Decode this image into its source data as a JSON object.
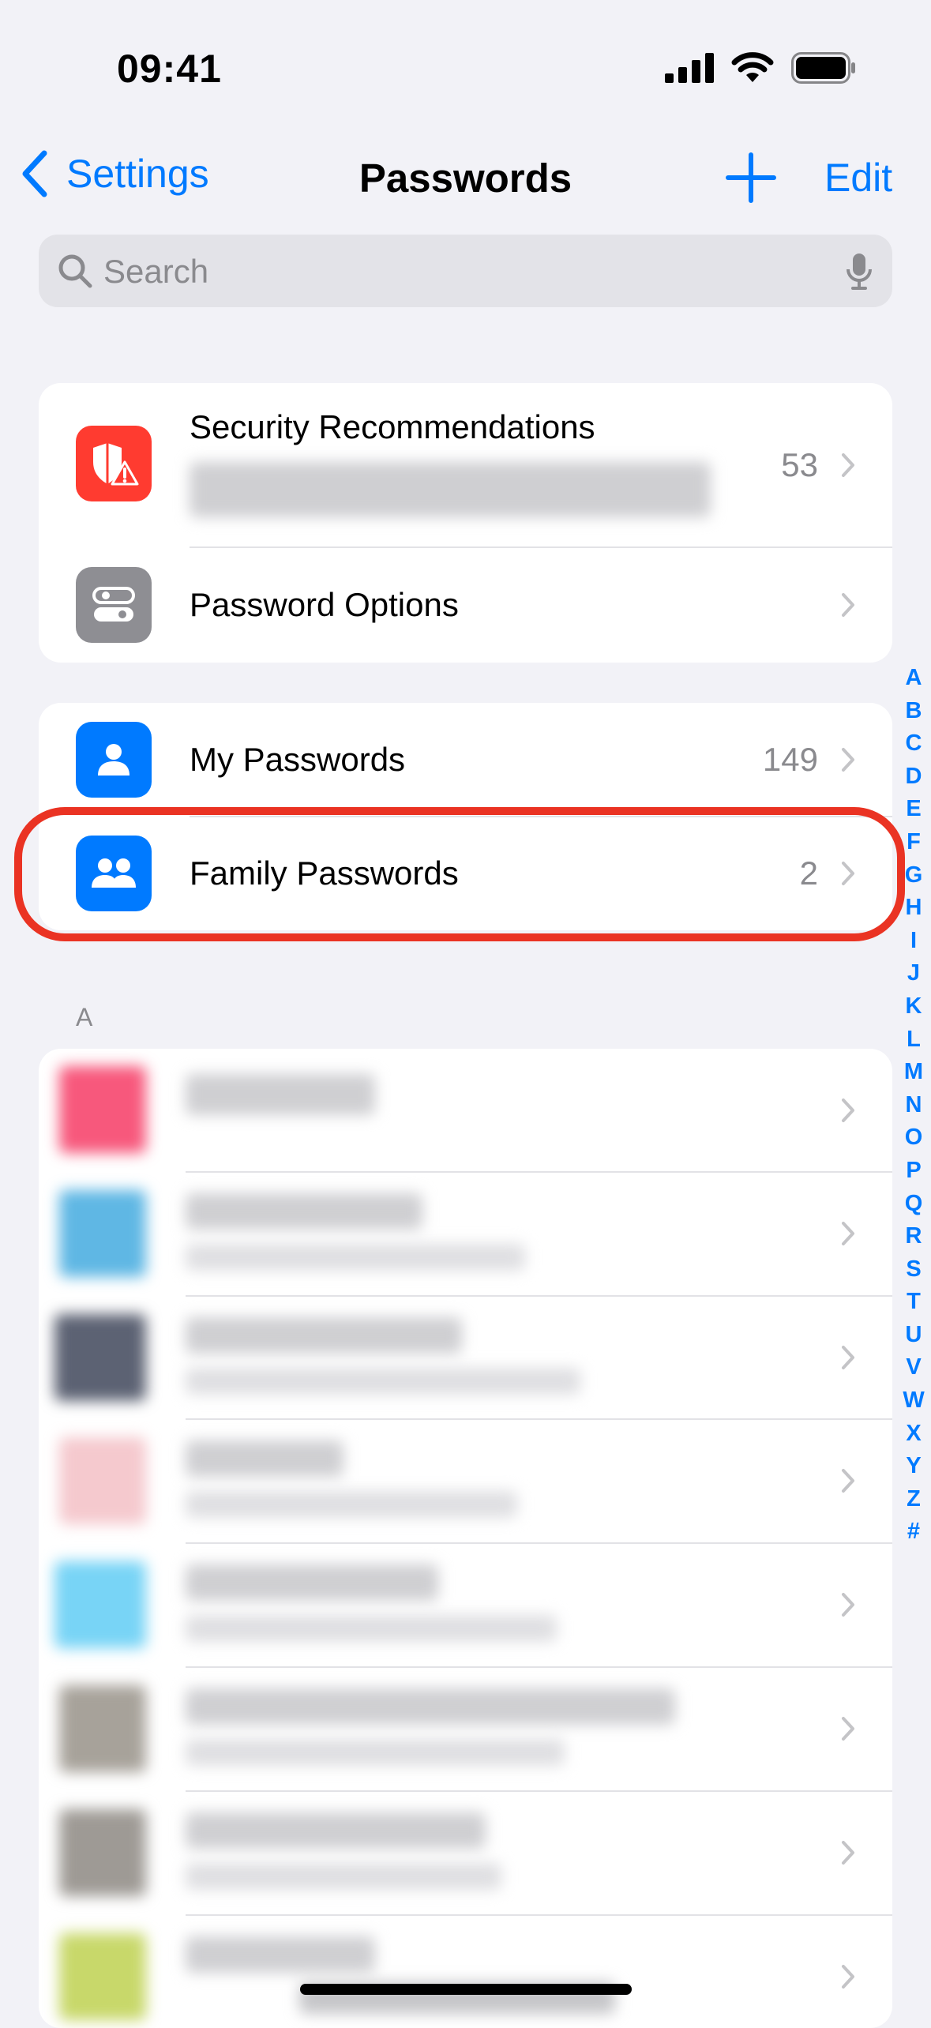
{
  "status_bar": {
    "time": "09:41"
  },
  "nav": {
    "back_label": "Settings",
    "title": "Passwords",
    "edit_label": "Edit"
  },
  "search": {
    "placeholder": "Search"
  },
  "top_group": {
    "security": {
      "label": "Security Recommendations",
      "count": "53"
    },
    "options": {
      "label": "Password Options"
    }
  },
  "groups": {
    "my": {
      "label": "My Passwords",
      "count": "149"
    },
    "family": {
      "label": "Family Passwords",
      "count": "2"
    }
  },
  "section_header": "A",
  "index_letters": [
    "A",
    "B",
    "C",
    "D",
    "E",
    "F",
    "G",
    "H",
    "I",
    "J",
    "K",
    "L",
    "M",
    "N",
    "O",
    "P",
    "Q",
    "R",
    "S",
    "T",
    "U",
    "V",
    "W",
    "X",
    "Y",
    "Z",
    "#"
  ],
  "colors": {
    "accent": "#007AFF",
    "security_icon": "#FF3B30",
    "options_icon": "#8E8E93",
    "highlight": "#EA3323"
  },
  "icons": {
    "security": "shield-warning-icon",
    "options": "toggle-icon",
    "my": "person-icon",
    "family": "people-icon"
  }
}
